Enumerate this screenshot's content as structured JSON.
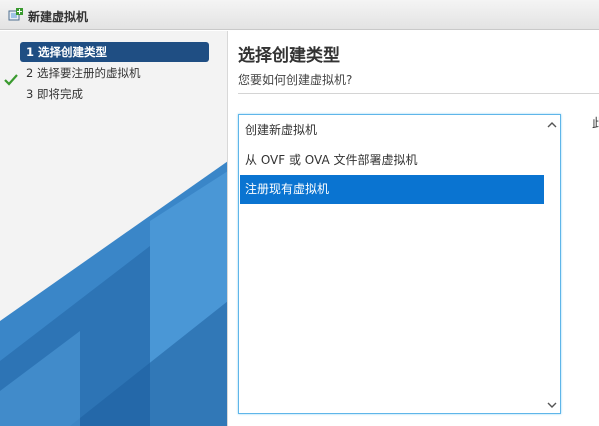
{
  "window": {
    "title": "新建虚拟机"
  },
  "sidebar": {
    "steps": [
      {
        "label": "1 选择创建类型",
        "active": true
      },
      {
        "label": "2 选择要注册的虚拟机",
        "active": false
      },
      {
        "label": "3 即将完成",
        "active": false
      }
    ]
  },
  "main": {
    "title": "选择创建类型",
    "subtitle": "您要如何创建虚拟机?",
    "options": [
      {
        "label": "创建新虚拟机"
      },
      {
        "label": "从 OVF 或 OVA 文件部署虚拟机"
      },
      {
        "label": "注册现有虚拟机"
      }
    ],
    "selected_option": "注册现有虚拟机",
    "side_text": "此"
  },
  "colors": {
    "active_step_bg": "#1f4e83",
    "selected_item_bg": "#0a74d1",
    "listbox_border": "#5fb6e9",
    "check_green": "#3a9a2f"
  },
  "icons": [
    "new-vm-icon",
    "check-icon",
    "scroll-up-icon",
    "scroll-down-icon"
  ]
}
